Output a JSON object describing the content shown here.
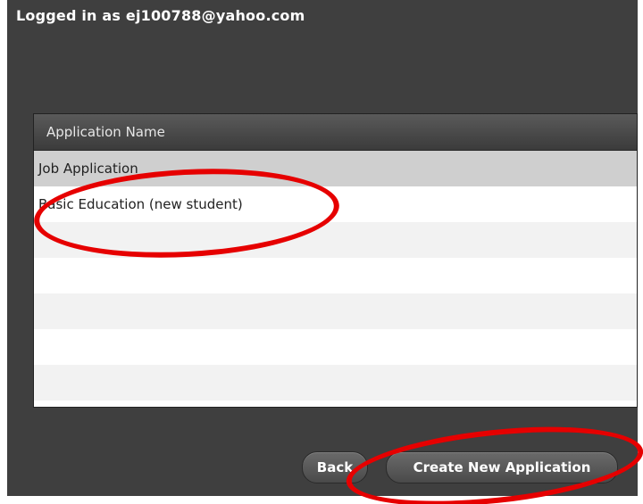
{
  "header": {
    "login_text": "Logged in as ej100788@yahoo.com"
  },
  "table": {
    "column_header": "Application Name",
    "rows": [
      "Job Application",
      "Basic Education (new student)"
    ]
  },
  "buttons": {
    "back": "Back",
    "create": "Create New Application"
  },
  "annotations": {
    "highlight_color": "#e60000"
  }
}
